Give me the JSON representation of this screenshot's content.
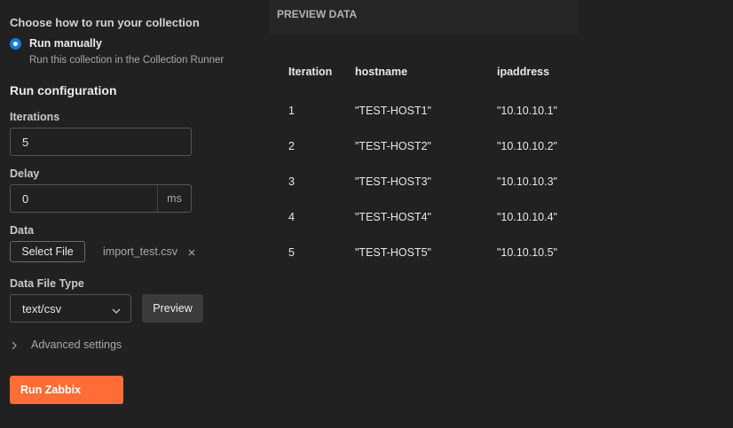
{
  "run_mode": {
    "heading": "Choose how to run your collection",
    "option_label": "Run manually",
    "option_description": "Run this collection in the Collection Runner"
  },
  "config": {
    "heading": "Run configuration",
    "iterations_label": "Iterations",
    "iterations_value": "5",
    "delay_label": "Delay",
    "delay_value": "0",
    "delay_unit": "ms",
    "data_label": "Data",
    "select_file_label": "Select File",
    "file_name": "import_test.csv",
    "file_type_label": "Data File Type",
    "file_type_value": "text/csv",
    "preview_button": "Preview",
    "advanced_label": "Advanced settings",
    "run_button": "Run Zabbix"
  },
  "preview": {
    "header": "PREVIEW DATA",
    "columns": [
      "Iteration",
      "hostname",
      "ipaddress"
    ],
    "rows": [
      [
        "1",
        "\"TEST-HOST1\"",
        "\"10.10.10.1\""
      ],
      [
        "2",
        "\"TEST-HOST2\"",
        "\"10.10.10.2\""
      ],
      [
        "3",
        "\"TEST-HOST3\"",
        "\"10.10.10.3\""
      ],
      [
        "4",
        "\"TEST-HOST4\"",
        "\"10.10.10.4\""
      ],
      [
        "5",
        "\"TEST-HOST5\"",
        "\"10.10.10.5\""
      ]
    ]
  },
  "colors": {
    "accent": "#ff6c37",
    "radio": "#0f7be6",
    "background": "#212121"
  },
  "icons": {
    "radio": "radio-selected-icon",
    "remove_file": "close-icon",
    "dropdown": "chevron-down-icon",
    "expand": "chevron-right-icon"
  }
}
